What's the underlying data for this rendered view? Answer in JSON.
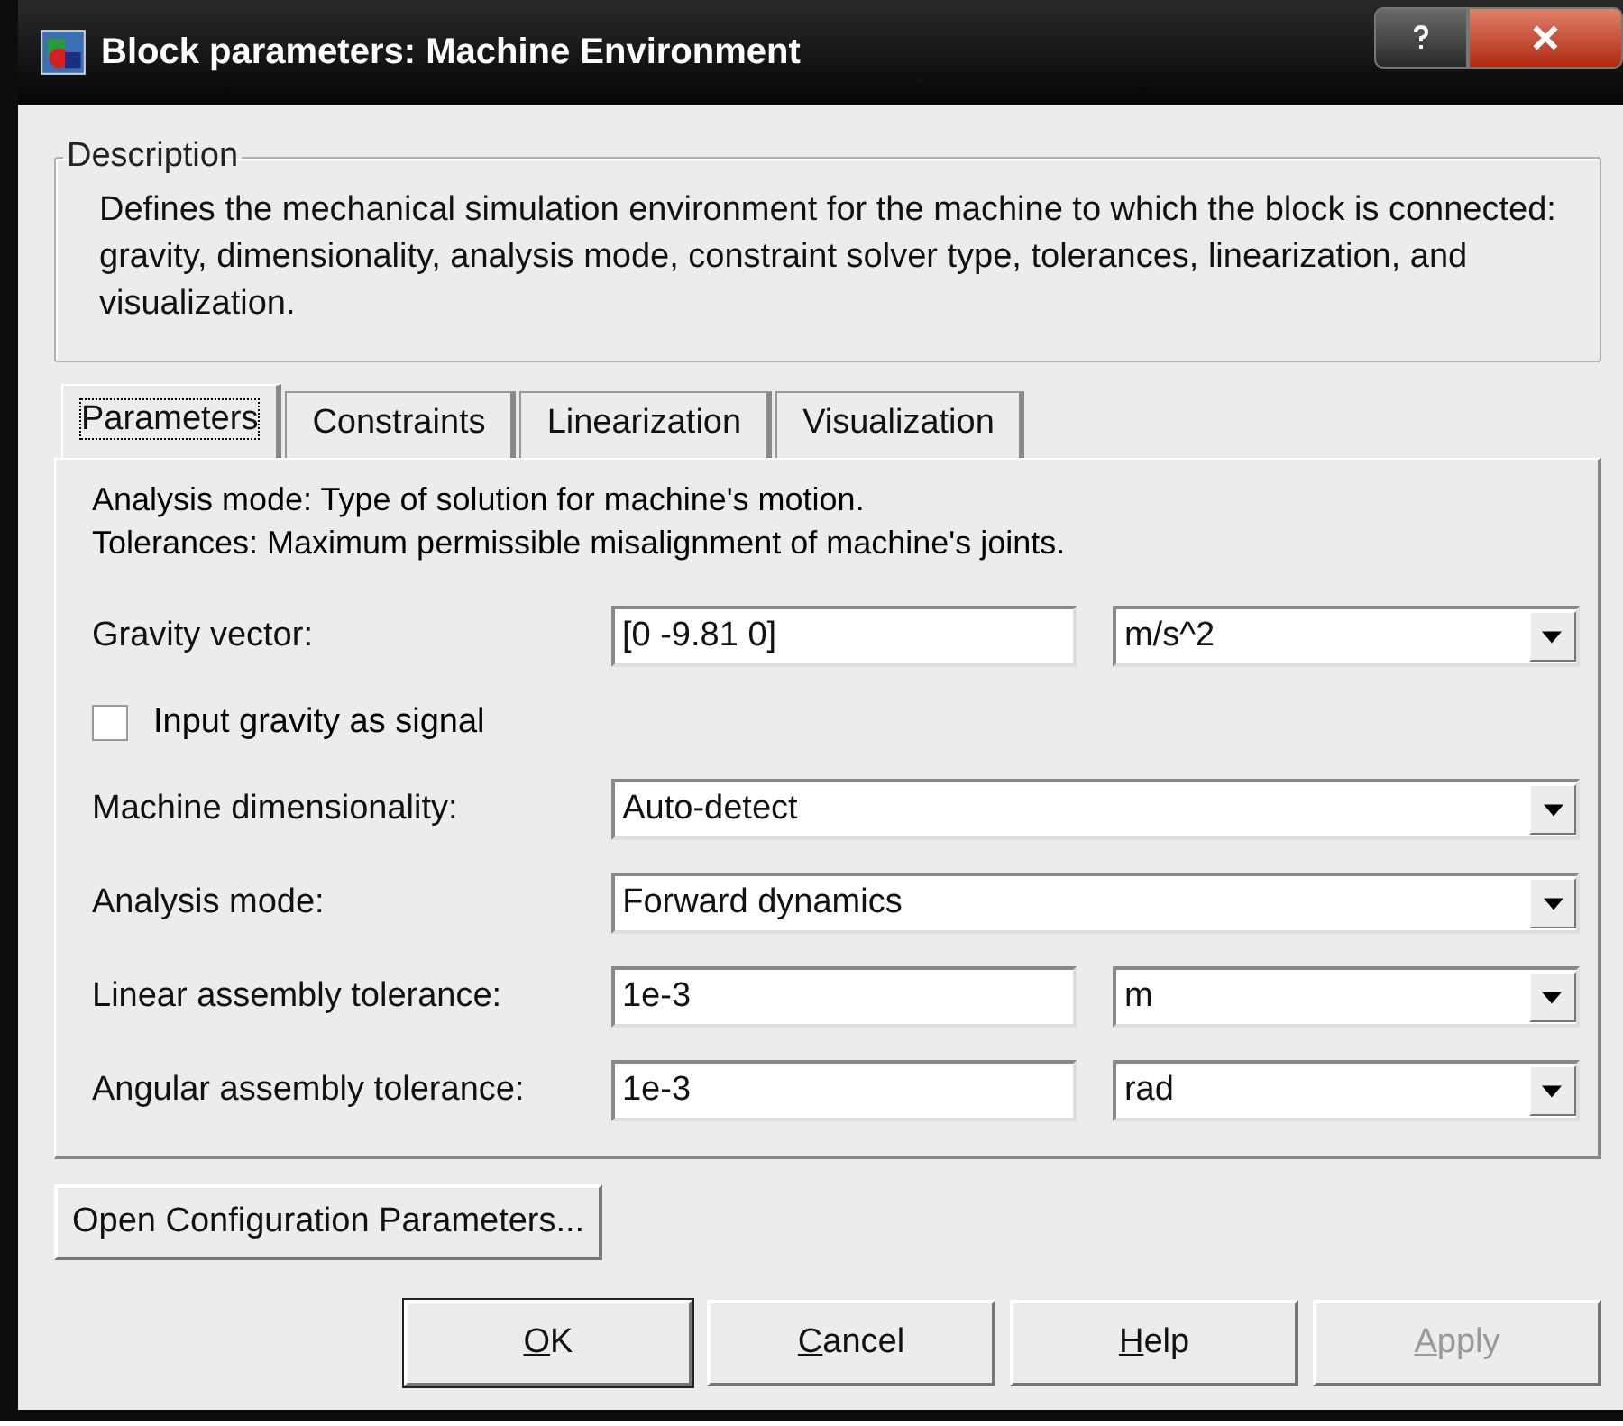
{
  "window": {
    "title": "Block parameters:  Machine Environment"
  },
  "description": {
    "legend": "Description",
    "text": "Defines the mechanical simulation environment for the machine to which the block is connected: gravity, dimensionality, analysis mode, constraint solver type, tolerances, linearization, and visualization."
  },
  "tabs": [
    {
      "label": "Parameters",
      "selected": true
    },
    {
      "label": "Constraints",
      "selected": false
    },
    {
      "label": "Linearization",
      "selected": false
    },
    {
      "label": "Visualization",
      "selected": false
    }
  ],
  "help_lines": [
    "Analysis mode: Type of solution for machine's motion.",
    "Tolerances: Maximum permissible misalignment of machine's joints."
  ],
  "fields": [
    {
      "kind": "value_unit",
      "label": "Gravity vector:",
      "value": "[0 -9.81 0]",
      "unit": "m/s^2"
    },
    {
      "kind": "checkbox",
      "label": "Input gravity as signal",
      "checked": false
    },
    {
      "kind": "select",
      "label": "Machine dimensionality:",
      "value": "Auto-detect"
    },
    {
      "kind": "select",
      "label": "Analysis mode:",
      "value": "Forward dynamics"
    },
    {
      "kind": "value_unit",
      "label": "Linear assembly tolerance:",
      "value": "1e-3",
      "unit": "m"
    },
    {
      "kind": "value_unit",
      "label": "Angular assembly tolerance:",
      "value": "1e-3",
      "unit": "rad"
    }
  ],
  "config_button": "Open Configuration Parameters...",
  "buttons": [
    {
      "access_key": "O",
      "rest": "K",
      "disabled": false
    },
    {
      "access_key": "C",
      "rest": "ancel",
      "disabled": false
    },
    {
      "access_key": "H",
      "rest": "elp",
      "disabled": false
    },
    {
      "access_key": "A",
      "rest": "pply",
      "disabled": true
    }
  ]
}
